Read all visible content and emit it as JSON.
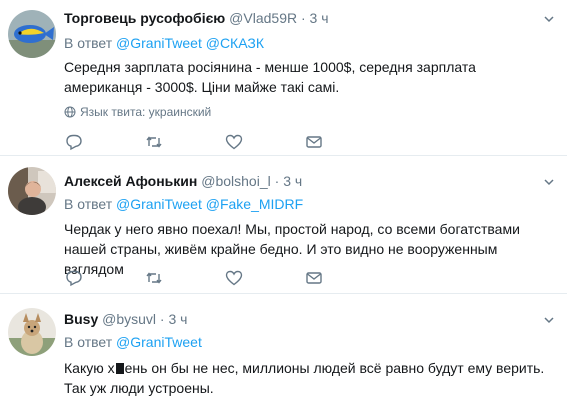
{
  "tweets": [
    {
      "author": "Торговець русофобією",
      "handle": "@Vlad59R",
      "dot": "·",
      "time": "3 ч",
      "reply_prefix": "В ответ",
      "mentions": [
        "@GraniTweet",
        "@СКАЗК"
      ],
      "text": "Середня зарплата росіянина - менше 1000$, середня зарплата американця - 3000$. Ціни майже такі самі.",
      "language_label": "Язык твита: украинский"
    },
    {
      "author": "Алексей Афонькин",
      "handle": "@bolshoi_l",
      "dot": "·",
      "time": "3 ч",
      "reply_prefix": "В ответ",
      "mentions": [
        "@GraniTweet",
        "@Fake_MIDRF"
      ],
      "text": "Чердак у него явно поехал! Мы, простой народ, со всеми богатствами нашей страны, живём крайне бедно. И это видно не вооруженным взглядом"
    },
    {
      "author": "Busy",
      "handle": "@bysuvl",
      "dot": "·",
      "time": "3 ч",
      "reply_prefix": "В ответ",
      "mentions": [
        "@GraniTweet"
      ],
      "text_before": "Какую х",
      "text_after": "ень он бы не нес, миллионы людей всё равно будут ему верить. Так уж люди устроены."
    }
  ],
  "icons": {
    "reply": "reply-icon",
    "retweet": "retweet-icon",
    "like": "like-icon",
    "message": "direct-message-icon",
    "globe": "globe-icon",
    "caret": "chevron-down-icon"
  },
  "colors": {
    "link": "#1da1f2",
    "muted": "#657786",
    "border": "#e6ecf0"
  }
}
